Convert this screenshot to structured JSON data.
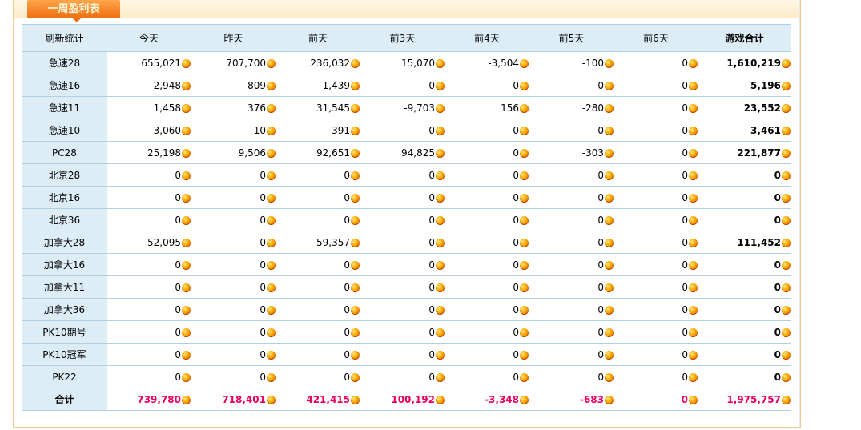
{
  "panel": {
    "title": "一周盈利表"
  },
  "table": {
    "headers": [
      "刷新统计",
      "今天",
      "昨天",
      "前天",
      "前3天",
      "前4天",
      "前5天",
      "前6天",
      "游戏合计"
    ],
    "rows": [
      {
        "name": "急速28",
        "values": [
          "655,021",
          "707,700",
          "236,032",
          "15,070",
          "-3,504",
          "-100",
          "0"
        ],
        "total": "1,610,219"
      },
      {
        "name": "急速16",
        "values": [
          "2,948",
          "809",
          "1,439",
          "0",
          "0",
          "0",
          "0"
        ],
        "total": "5,196"
      },
      {
        "name": "急速11",
        "values": [
          "1,458",
          "376",
          "31,545",
          "-9,703",
          "156",
          "-280",
          "0"
        ],
        "total": "23,552"
      },
      {
        "name": "急速10",
        "values": [
          "3,060",
          "10",
          "391",
          "0",
          "0",
          "0",
          "0"
        ],
        "total": "3,461"
      },
      {
        "name": "PC28",
        "values": [
          "25,198",
          "9,506",
          "92,651",
          "94,825",
          "0",
          "-303",
          "0"
        ],
        "total": "221,877"
      },
      {
        "name": "北京28",
        "values": [
          "0",
          "0",
          "0",
          "0",
          "0",
          "0",
          "0"
        ],
        "total": "0"
      },
      {
        "name": "北京16",
        "values": [
          "0",
          "0",
          "0",
          "0",
          "0",
          "0",
          "0"
        ],
        "total": "0"
      },
      {
        "name": "北京36",
        "values": [
          "0",
          "0",
          "0",
          "0",
          "0",
          "0",
          "0"
        ],
        "total": "0"
      },
      {
        "name": "加拿大28",
        "values": [
          "52,095",
          "0",
          "59,357",
          "0",
          "0",
          "0",
          "0"
        ],
        "total": "111,452"
      },
      {
        "name": "加拿大16",
        "values": [
          "0",
          "0",
          "0",
          "0",
          "0",
          "0",
          "0"
        ],
        "total": "0"
      },
      {
        "name": "加拿大11",
        "values": [
          "0",
          "0",
          "0",
          "0",
          "0",
          "0",
          "0"
        ],
        "total": "0"
      },
      {
        "name": "加拿大36",
        "values": [
          "0",
          "0",
          "0",
          "0",
          "0",
          "0",
          "0"
        ],
        "total": "0"
      },
      {
        "name": "PK10期号",
        "values": [
          "0",
          "0",
          "0",
          "0",
          "0",
          "0",
          "0"
        ],
        "total": "0"
      },
      {
        "name": "PK10冠军",
        "values": [
          "0",
          "0",
          "0",
          "0",
          "0",
          "0",
          "0"
        ],
        "total": "0"
      },
      {
        "name": "PK22",
        "values": [
          "0",
          "0",
          "0",
          "0",
          "0",
          "0",
          "0"
        ],
        "total": "0"
      }
    ],
    "summary": {
      "name": "合计",
      "values": [
        "739,780",
        "718,401",
        "421,415",
        "100,192",
        "-3,348",
        "-683",
        "0"
      ],
      "total": "1,975,757"
    }
  },
  "icons": {
    "value_suffix": "gold-coin-icon"
  },
  "colors": {
    "tab": "#ee6e10",
    "header_bg": "#dcedf6",
    "border": "#aed0e4",
    "summary_text": "#e8005a"
  }
}
